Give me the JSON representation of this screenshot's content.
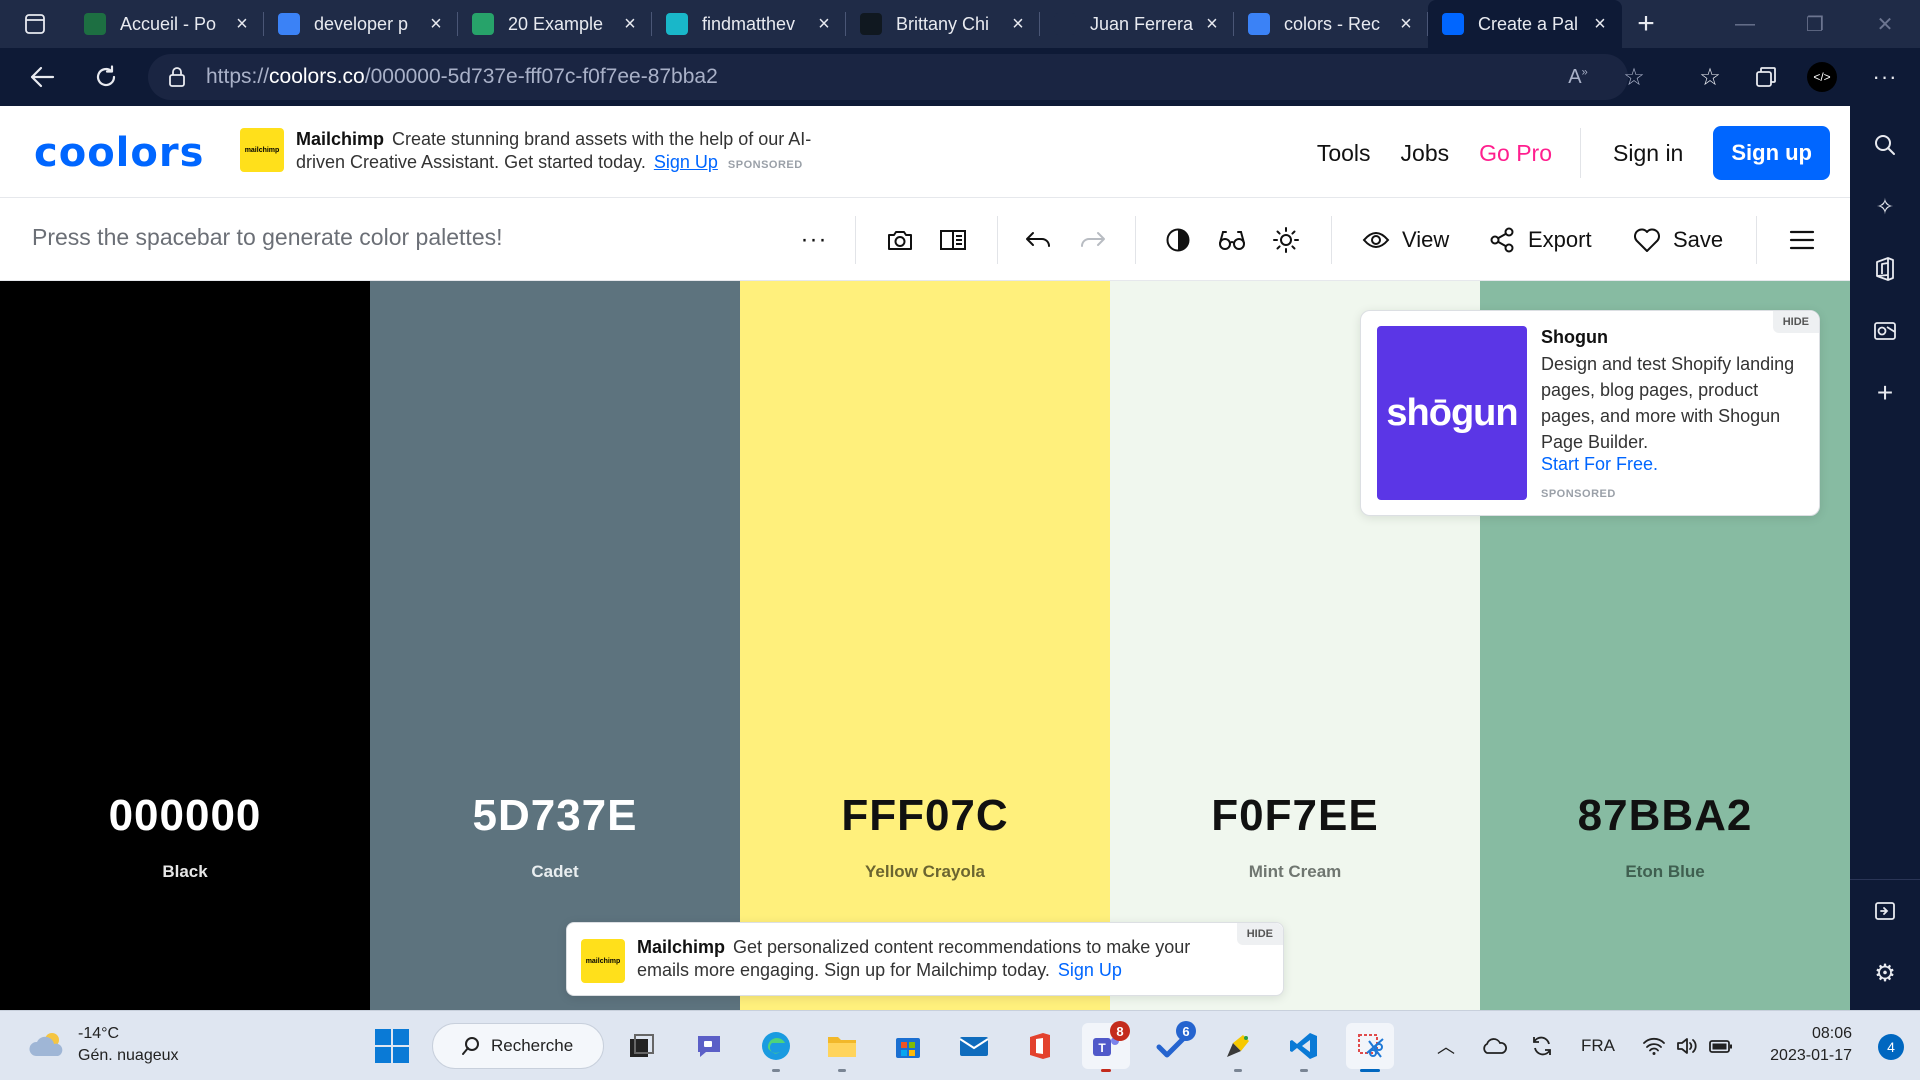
{
  "browser": {
    "tabs": [
      {
        "title": "Accueil - Po",
        "favicon": "excel-online-icon",
        "color": "#1d6f42"
      },
      {
        "title": "developer p",
        "favicon": "search-icon",
        "color": "#3b82f6"
      },
      {
        "title": "20 Example",
        "favicon": "sheet-icon",
        "color": "#27a36a"
      },
      {
        "title": "findmatthev",
        "favicon": "m-icon",
        "color": "#19b7c9"
      },
      {
        "title": "Brittany Chi",
        "favicon": "b-icon",
        "color": "#101820"
      },
      {
        "title": "Juan Ferrera",
        "favicon": "jf-icon",
        "color": "#1f2b47"
      },
      {
        "title": "colors - Rec",
        "favicon": "search-icon",
        "color": "#3b82f6"
      },
      {
        "title": "Create a Pal",
        "favicon": "coolors-icon",
        "color": "#0066ff",
        "active": true
      }
    ],
    "url_prefix": "https://",
    "url_domain": "coolors.co",
    "url_path": "/000000-5d737e-fff07c-f0f7ee-87bba2"
  },
  "site": {
    "logo": "coolors",
    "sponsor": {
      "badge": "mailchimp",
      "brand": "Mailchimp",
      "text": "Create stunning brand assets with the help of our AI-driven Creative Assistant. Get started today.",
      "cta": "Sign Up",
      "tag": "SPONSORED"
    },
    "nav": {
      "tools": "Tools",
      "jobs": "Jobs",
      "gopro": "Go Pro",
      "signin": "Sign in",
      "signup": "Sign up"
    }
  },
  "toolbar": {
    "hint": "Press the spacebar to generate color palettes!",
    "view": "View",
    "export": "Export",
    "save": "Save"
  },
  "palette": [
    {
      "hex": "000000",
      "name": "Black",
      "bg": "#000000",
      "hex_color": "#ffffff",
      "name_color": "#e6e6e6"
    },
    {
      "hex": "5D737E",
      "name": "Cadet",
      "bg": "#5d737e",
      "hex_color": "#ffffff",
      "name_color": "#e9eef0"
    },
    {
      "hex": "FFF07C",
      "name": "Yellow Crayola",
      "bg": "#fff07c",
      "hex_color": "#111111",
      "name_color": "#6b6530"
    },
    {
      "hex": "F0F7EE",
      "name": "Mint Cream",
      "bg": "#f0f7ee",
      "hex_color": "#111111",
      "name_color": "#6f7670"
    },
    {
      "hex": "87BBA2",
      "name": "Eton Blue",
      "bg": "#87bba2",
      "hex_color": "#111111",
      "name_color": "#3f5f50"
    }
  ],
  "ad_card": {
    "image_text": "shōgun",
    "brand": "Shogun",
    "desc": "Design and test Shopify landing pages, blog pages, product pages, and more with Shogun Page Builder.",
    "cta": "Start For Free.",
    "tag": "SPONSORED",
    "hide": "HIDE"
  },
  "ad_bottom": {
    "badge": "mailchimp",
    "brand": "Mailchimp",
    "text": "Get personalized content recommendations to make your emails more engaging. Sign up for Mailchimp today.",
    "cta": "Sign Up",
    "hide": "HIDE"
  },
  "taskbar": {
    "weather_temp": "-14°C",
    "weather_desc": "Gén. nuageux",
    "search_label": "Recherche",
    "teams_badge": "8",
    "todo_badge": "6",
    "lang": "FRA",
    "time": "08:06",
    "date": "2023-01-17",
    "notifications": "4"
  }
}
